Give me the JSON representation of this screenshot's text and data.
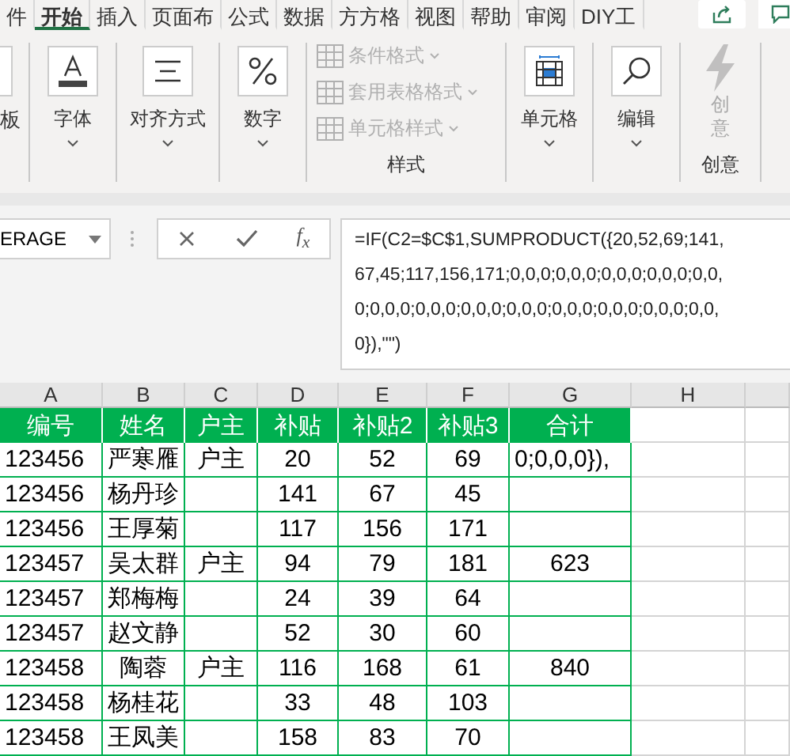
{
  "tabs": [
    {
      "label": "件",
      "selected": false
    },
    {
      "label": "开始",
      "selected": true
    },
    {
      "label": "插入",
      "selected": false
    },
    {
      "label": "页面布",
      "selected": false
    },
    {
      "label": "公式",
      "selected": false
    },
    {
      "label": "数据",
      "selected": false
    },
    {
      "label": "方方格",
      "selected": false
    },
    {
      "label": "视图",
      "selected": false
    },
    {
      "label": "帮助",
      "selected": false
    },
    {
      "label": "审阅",
      "selected": false
    },
    {
      "label": "DIY工",
      "selected": false
    }
  ],
  "ribbon": {
    "clipboard_label": "板",
    "left_buttons": [
      {
        "label": "字体",
        "kind": "font"
      },
      {
        "label": "对齐方式",
        "kind": "align"
      },
      {
        "label": "数字",
        "kind": "percent"
      }
    ],
    "styles": {
      "items": [
        {
          "label": "条件格式",
          "disabled": true
        },
        {
          "label": "套用表格格式",
          "disabled": true
        },
        {
          "label": "单元格样式",
          "disabled": true
        }
      ],
      "group_label": "样式"
    },
    "right_buttons": [
      {
        "label": "单元格",
        "kind": "cells"
      },
      {
        "label": "编辑",
        "kind": "search"
      }
    ],
    "creative": {
      "label_lines": [
        "创",
        "意"
      ],
      "disabled": true,
      "group_label": "创意"
    }
  },
  "formula_bar": {
    "name_box": "ERAGE",
    "function_label": "f$_{x}$",
    "formula_lines": [
      "=IF(C2=$C$1,SUMPRODUCT({20,52,69;141,",
      "67,45;117,156,171;0,0,0;0,0,0;0,0,0;0,0,0;0,0,",
      "0;0,0,0;0,0,0;0,0,0;0,0,0;0,0,0;0,0,0;0,0,0;0,0,",
      "0}),\"\")"
    ]
  },
  "sheet": {
    "column_headers": [
      "A",
      "B",
      "C",
      "D",
      "E",
      "F",
      "G",
      "H"
    ],
    "header_row": [
      "编号",
      "姓名",
      "户主",
      "补贴",
      "补贴2",
      "补贴3",
      "合计"
    ],
    "rows": [
      [
        "123456",
        "严寒雁",
        "户主",
        "20",
        "52",
        "69",
        "0;0,0,0}),"
      ],
      [
        "123456",
        "杨丹珍",
        "",
        "141",
        "67",
        "45",
        ""
      ],
      [
        "123456",
        "王厚菊",
        "",
        "117",
        "156",
        "171",
        ""
      ],
      [
        "123457",
        "吴太群",
        "户主",
        "94",
        "79",
        "181",
        "623"
      ],
      [
        "123457",
        "郑梅梅",
        "",
        "24",
        "39",
        "64",
        ""
      ],
      [
        "123457",
        "赵文静",
        "",
        "52",
        "30",
        "60",
        ""
      ],
      [
        "123458",
        "陶蓉",
        "户主",
        "116",
        "168",
        "61",
        "840"
      ],
      [
        "123458",
        "杨桂花",
        "",
        "33",
        "48",
        "103",
        ""
      ],
      [
        "123458",
        "王凤美",
        "",
        "158",
        "83",
        "70",
        ""
      ]
    ]
  }
}
